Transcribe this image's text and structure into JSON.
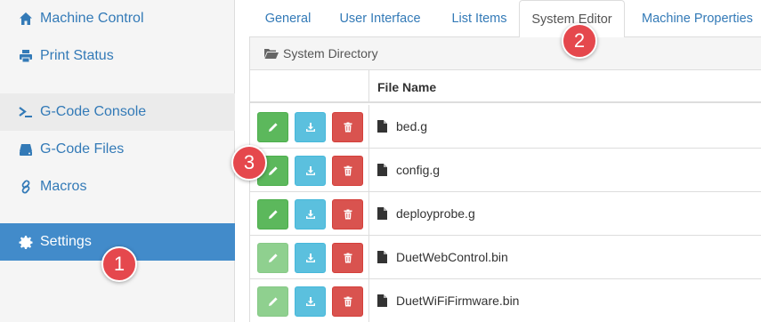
{
  "sidebar": {
    "items": [
      {
        "label": "Machine Control",
        "icon": "home-icon"
      },
      {
        "label": "Print Status",
        "icon": "printer-icon"
      },
      {
        "label": "G-Code Console",
        "icon": "console-icon"
      },
      {
        "label": "G-Code Files",
        "icon": "hdd-icon"
      },
      {
        "label": "Macros",
        "icon": "link-icon"
      },
      {
        "label": "Settings",
        "icon": "gear-icon"
      }
    ]
  },
  "tabs": [
    {
      "label": "General"
    },
    {
      "label": "User Interface"
    },
    {
      "label": "List Items"
    },
    {
      "label": "System Editor"
    },
    {
      "label": "Machine Properties"
    }
  ],
  "panel": {
    "heading": "System Directory",
    "column_header": "File Name",
    "files": [
      {
        "name": "bed.g",
        "edit_enabled": true
      },
      {
        "name": "config.g",
        "edit_enabled": true
      },
      {
        "name": "deployprobe.g",
        "edit_enabled": true
      },
      {
        "name": "DuetWebControl.bin",
        "edit_enabled": false
      },
      {
        "name": "DuetWiFiFirmware.bin",
        "edit_enabled": false
      }
    ]
  },
  "callouts": [
    {
      "number": "1"
    },
    {
      "number": "2"
    },
    {
      "number": "3"
    }
  ],
  "colors": {
    "link": "#337ab7",
    "active_nav": "#428bca",
    "edit_button": "#5cb85c",
    "download_button": "#5bc0de",
    "delete_button": "#d9534f",
    "callout": "#e5484d"
  }
}
